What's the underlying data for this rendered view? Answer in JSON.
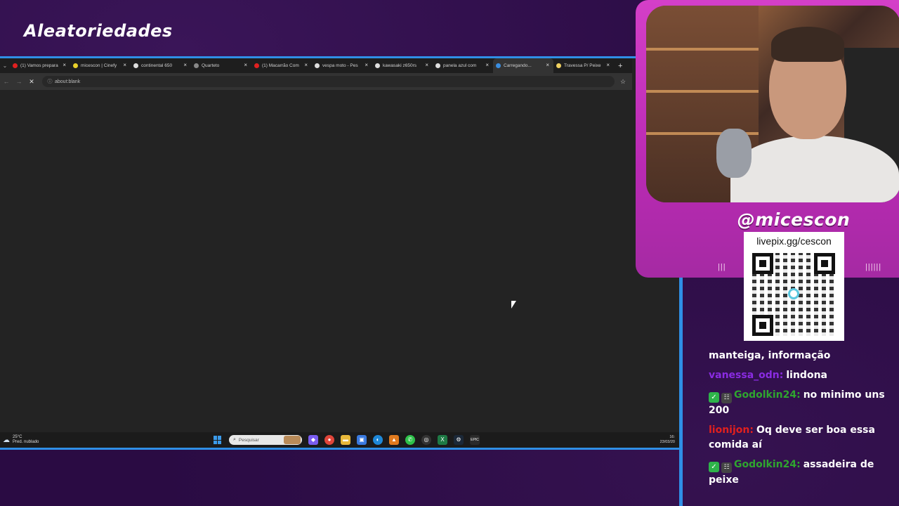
{
  "overlay": {
    "title": "Aleatoriedades",
    "handle": "@micescon",
    "livepix_url": "livepix.gg/cescon"
  },
  "browser": {
    "tabs": [
      {
        "label": "(1) Vamos preparar",
        "favicon_color": "#e02020"
      },
      {
        "label": "micescon | Cinefy",
        "favicon_color": "#e8d02a"
      },
      {
        "label": "continental 650",
        "favicon_color": "#dddddd"
      },
      {
        "label": "Quarteto",
        "favicon_color": "#888888"
      },
      {
        "label": "(1) Macarrão Com",
        "favicon_color": "#e02020"
      },
      {
        "label": "vespa moto - Pes",
        "favicon_color": "#dddddd"
      },
      {
        "label": "kawasaki z650rs",
        "favicon_color": "#dddddd"
      },
      {
        "label": "panela azul com",
        "favicon_color": "#dddddd"
      },
      {
        "label": "Carregando...",
        "favicon_color": "#3a8de0",
        "active": true
      },
      {
        "label": "Travessa P/ Peixe",
        "favicon_color": "#f0d060"
      }
    ],
    "close_glyph": "×",
    "new_tab_glyph": "+",
    "address": "about:blank"
  },
  "taskbar": {
    "weather_temp": "25°C",
    "weather_desc": "Pred. nublado",
    "search_placeholder": "Pesquisar",
    "clock_time": "16:",
    "clock_date": "23/03/20"
  },
  "chat": {
    "messages": [
      {
        "user": "",
        "user_color": "#ffffff",
        "badges": [],
        "text": "manteiga, informação"
      },
      {
        "user": "vanessa_odn:",
        "user_color": "#8a2be2",
        "badges": [],
        "text": "lindona"
      },
      {
        "user": "Godolkin24:",
        "user_color": "#2fa52f",
        "badges": [
          "check",
          "tag"
        ],
        "text": "no minimo uns 200"
      },
      {
        "user": "lionijon:",
        "user_color": "#e0201e",
        "badges": [],
        "text": "Oq deve ser boa essa comida aí"
      },
      {
        "user": "Godolkin24:",
        "user_color": "#2fa52f",
        "badges": [
          "check",
          "tag"
        ],
        "text": "assadeira de peixe"
      }
    ]
  },
  "colors": {
    "background": "#2a0b43",
    "window_border": "#2f8fe6",
    "cam_frame": "#d43fc8"
  }
}
